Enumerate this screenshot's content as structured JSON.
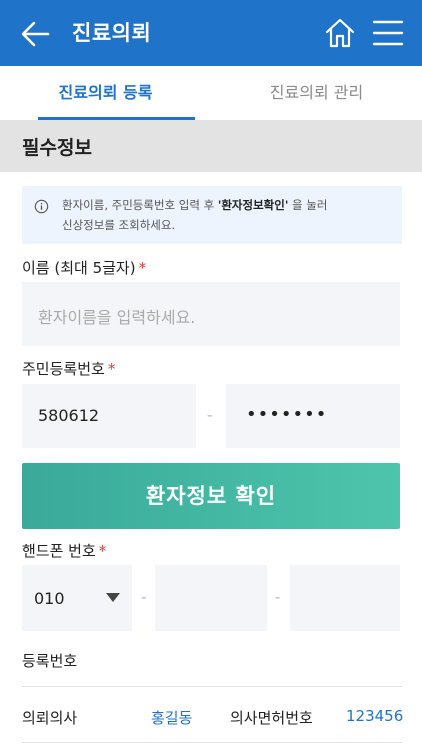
{
  "header": {
    "title": "진료의뢰"
  },
  "tabs": [
    {
      "label": "진료의뢰 등록",
      "active": true
    },
    {
      "label": "진료의뢰 관리",
      "active": false
    }
  ],
  "section": {
    "title": "필수정보"
  },
  "notice": {
    "line1_prefix": "환자이름, 주민등록번호 입력 후 ",
    "line1_emphasis": "'환자정보확인'",
    "line1_suffix": " 을 눌러",
    "line2": "신상정보를 조회하세요."
  },
  "name_field": {
    "label": "이름 (최대 5글자)",
    "required_mark": "*",
    "placeholder": "환자이름을 입력하세요."
  },
  "resident_field": {
    "label": "주민등록번호",
    "required_mark": "*",
    "front": "580612",
    "back_masked": "•••••••",
    "separator": "-"
  },
  "confirm_button": {
    "label": "환자정보 확인"
  },
  "phone_field": {
    "label": "핸드폰 번호",
    "required_mark": "*",
    "prefix": "010",
    "separator": "-"
  },
  "registration": {
    "label": "등록번호"
  },
  "doctor_row": {
    "doctor_label": "의뢰의사",
    "doctor_value": "홍길동",
    "license_label": "의사면허번호",
    "license_value": "123456"
  },
  "colors": {
    "primary": "#1f73c9",
    "button_gradient_start": "#3aa99a",
    "button_gradient_end": "#4dc5ab",
    "required": "#e53935"
  }
}
